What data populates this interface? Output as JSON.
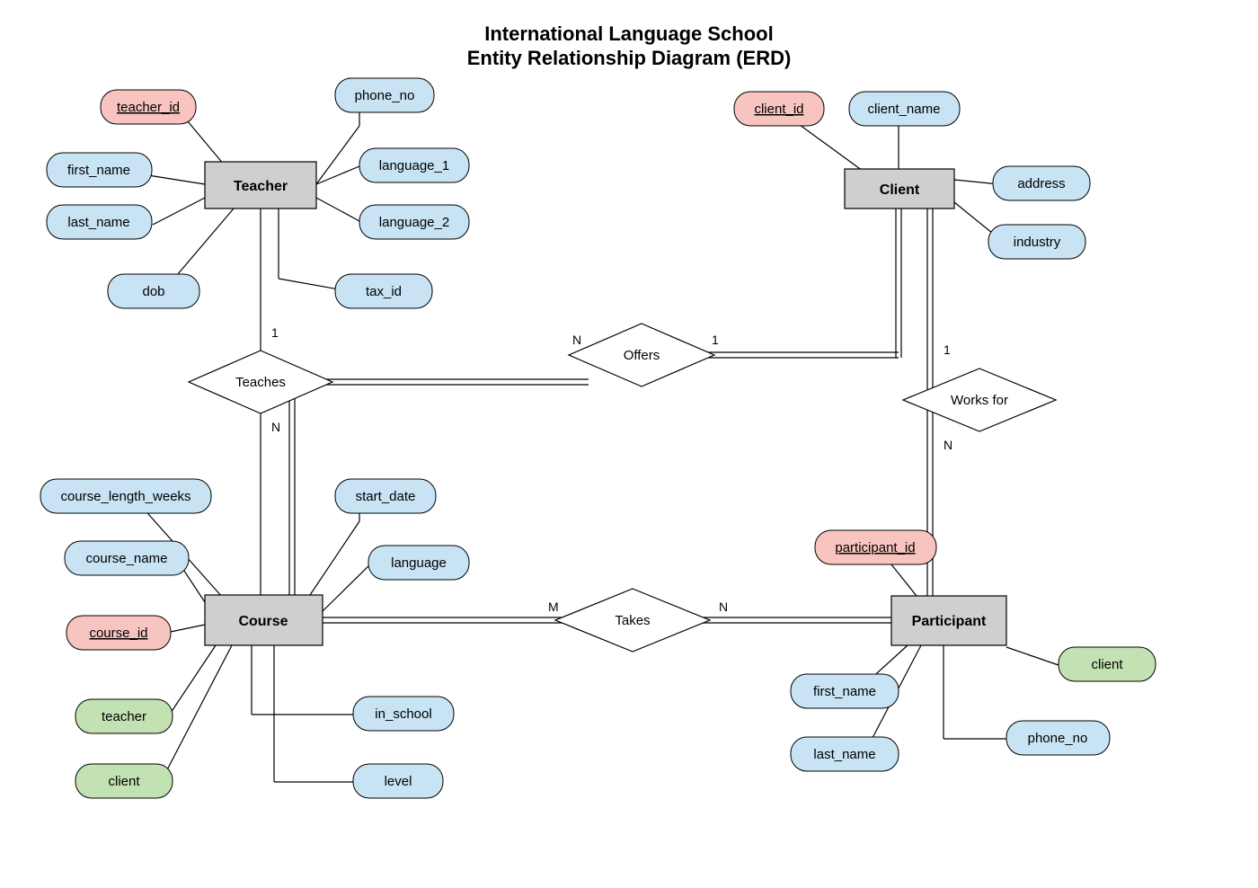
{
  "title": {
    "line1": "International Language School",
    "line2": "Entity Relationship Diagram (ERD)"
  },
  "entities": {
    "teacher": "Teacher",
    "client": "Client",
    "course": "Course",
    "participant": "Participant"
  },
  "relationships": {
    "teaches": "Teaches",
    "offers": "Offers",
    "works_for": "Works for",
    "takes": "Takes"
  },
  "cardinality": {
    "teacher_teaches_1": "1",
    "teaches_course_N": "N",
    "offers_N": "N",
    "offers_1": "1",
    "worksfor_1": "1",
    "worksfor_N": "N",
    "takes_M": "M",
    "takes_N": "N"
  },
  "attrs": {
    "teacher_id": "teacher_id",
    "first_name": "first_name",
    "last_name": "last_name",
    "dob": "dob",
    "phone_no": "phone_no",
    "language_1": "language_1",
    "language_2": "language_2",
    "tax_id": "tax_id",
    "client_id": "client_id",
    "client_name": "client_name",
    "address": "address",
    "industry": "industry",
    "course_length_weeks": "course_length_weeks",
    "course_name": "course_name",
    "course_id": "course_id",
    "teacher_fk": "teacher",
    "client_fk": "client",
    "start_date": "start_date",
    "language": "language",
    "in_school": "in_school",
    "level": "level",
    "participant_id": "participant_id",
    "p_first_name": "first_name",
    "p_last_name": "last_name",
    "p_phone_no": "phone_no",
    "p_client_fk": "client"
  }
}
